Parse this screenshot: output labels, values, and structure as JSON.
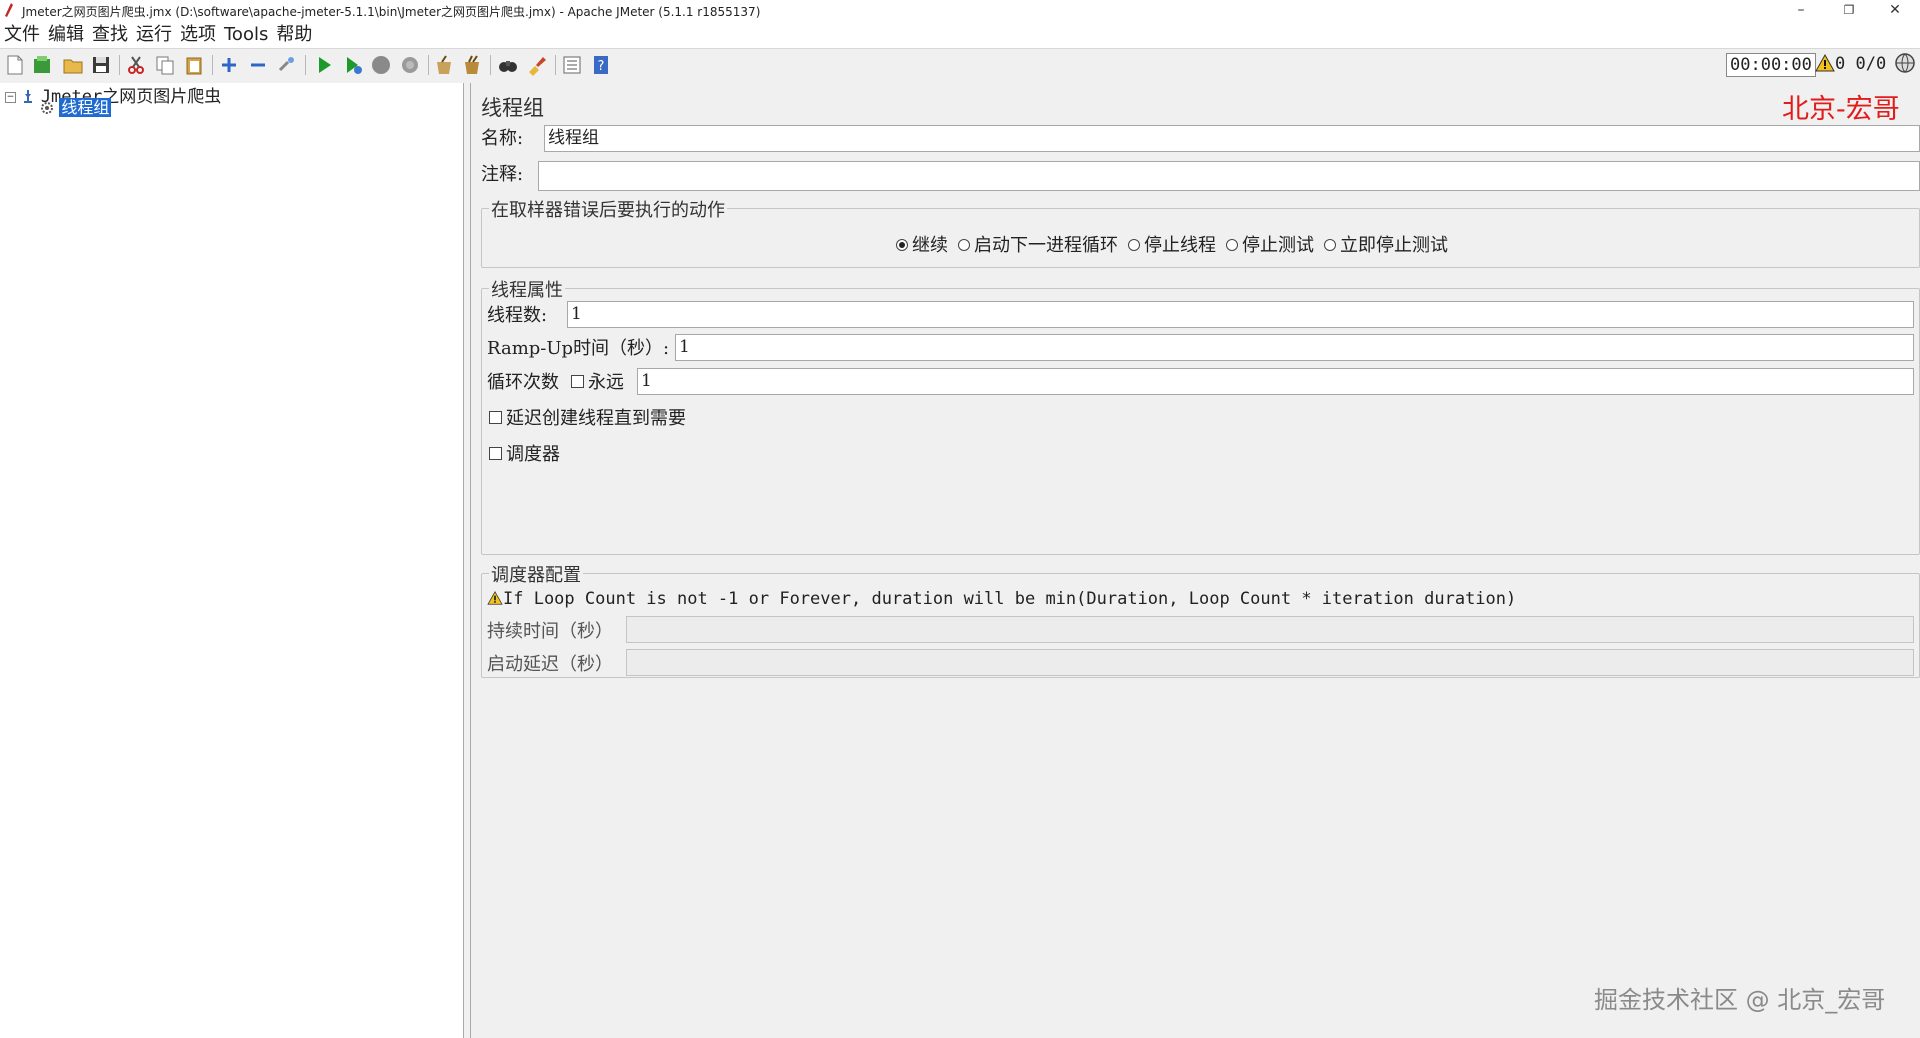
{
  "window": {
    "title": "Jmeter之网页图片爬虫.jmx (D:\\software\\apache-jmeter-5.1.1\\bin\\Jmeter之网页图片爬虫.jmx) - Apache JMeter (5.1.1 r1855137)",
    "minimize": "–",
    "restore": "❐",
    "close": "✕"
  },
  "menu": [
    "文件",
    "编辑",
    "查找",
    "运行",
    "选项",
    "Tools",
    "帮助"
  ],
  "toolbar": {
    "icons": [
      "new-icon",
      "templates-icon",
      "open-icon",
      "save-icon",
      "cut-icon",
      "copy-icon",
      "paste-icon",
      "expand-icon",
      "collapse-icon",
      "toggle-icon",
      "start-icon",
      "start-no-pause-icon",
      "stop-icon",
      "shutdown-icon",
      "clear-icon",
      "clear-all-icon",
      "search-icon",
      "reset-search-icon",
      "function-helper-icon",
      "help-icon"
    ],
    "timer": "00:00:00",
    "warning_count": "0",
    "threads": "0/0"
  },
  "tree": {
    "root": "Jmeter之网页图片爬虫",
    "child": "线程组"
  },
  "thread_group": {
    "title": "线程组",
    "name_label": "名称:",
    "name_value": "线程组",
    "comment_label": "注释:",
    "comment_value": "",
    "error_action_title": "在取样器错误后要执行的动作",
    "error_actions": [
      "继续",
      "启动下一进程循环",
      "停止线程",
      "停止测试",
      "立即停止测试"
    ],
    "error_action_selected": 0,
    "props_title": "线程属性",
    "threads_label": "线程数:",
    "threads_value": "1",
    "rampup_label": "Ramp-Up时间（秒）:",
    "rampup_value": "1",
    "loop_label": "循环次数",
    "forever_label": "永远",
    "loop_value": "1",
    "delay_label": "延迟创建线程直到需要",
    "scheduler_label": "调度器",
    "scheduler_title": "调度器配置",
    "scheduler_warning": "If Loop Count is not -1 or Forever, duration will be min(Duration, Loop Count * iteration duration)",
    "duration_label": "持续时间（秒）",
    "duration_value": "",
    "startup_delay_label": "启动延迟（秒）",
    "startup_delay_value": ""
  },
  "watermarks": {
    "red": "北京-宏哥",
    "gray": "掘金技术社区 @ 北京_宏哥"
  }
}
